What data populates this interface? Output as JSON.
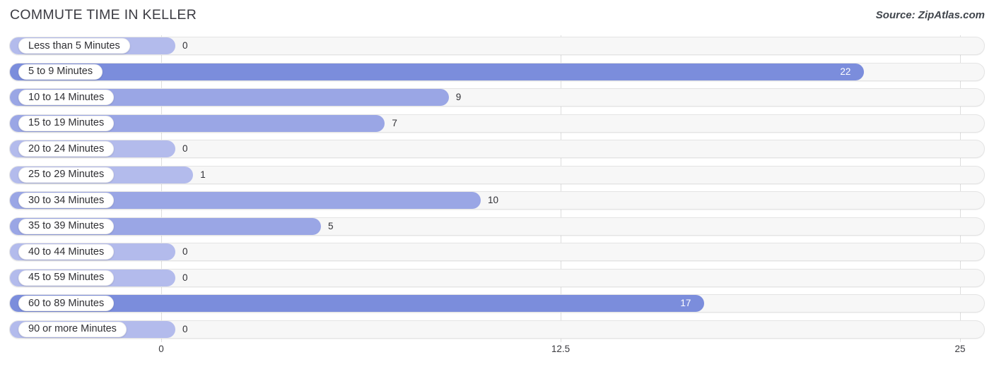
{
  "header": {
    "title": "COMMUTE TIME IN KELLER",
    "source": "Source: ZipAtlas.com"
  },
  "colors": {
    "bar_strong": "#7b8ddc",
    "bar_mid": "#9aa6e5",
    "bar_light": "#b3bbec",
    "track": "#f7f7f7",
    "gridline": "#dedede",
    "title_text": "#3b3b42",
    "value_text": "#303035",
    "value_text_inside": "#ffffff"
  },
  "axis": {
    "ticks": [
      {
        "label": "0",
        "value": 0
      },
      {
        "label": "12.5",
        "value": 12.5
      },
      {
        "label": "25",
        "value": 25
      }
    ],
    "min": 0,
    "max": 25
  },
  "chart_data": {
    "type": "bar",
    "orientation": "horizontal",
    "title": "COMMUTE TIME IN KELLER",
    "subtitle": "Source: ZipAtlas.com",
    "xlabel": "",
    "ylabel": "",
    "xlim": [
      0,
      25
    ],
    "grid": true,
    "legend": "none",
    "categories": [
      "Less than 5 Minutes",
      "5 to 9 Minutes",
      "10 to 14 Minutes",
      "15 to 19 Minutes",
      "20 to 24 Minutes",
      "25 to 29 Minutes",
      "30 to 34 Minutes",
      "35 to 39 Minutes",
      "40 to 44 Minutes",
      "45 to 59 Minutes",
      "60 to 89 Minutes",
      "90 or more Minutes"
    ],
    "values": [
      0,
      22,
      9,
      7,
      0,
      1,
      10,
      5,
      0,
      0,
      17,
      0
    ],
    "value_labels": [
      "0",
      "22",
      "9",
      "7",
      "0",
      "1",
      "10",
      "5",
      "0",
      "0",
      "17",
      "0"
    ]
  },
  "rows": [
    {
      "label": "Less than 5 Minutes",
      "value": 0,
      "value_label": "0",
      "shade": "light",
      "inside": false
    },
    {
      "label": "5 to 9 Minutes",
      "value": 22,
      "value_label": "22",
      "shade": "strong",
      "inside": true
    },
    {
      "label": "10 to 14 Minutes",
      "value": 9,
      "value_label": "9",
      "shade": "mid",
      "inside": false
    },
    {
      "label": "15 to 19 Minutes",
      "value": 7,
      "value_label": "7",
      "shade": "mid",
      "inside": false
    },
    {
      "label": "20 to 24 Minutes",
      "value": 0,
      "value_label": "0",
      "shade": "light",
      "inside": false
    },
    {
      "label": "25 to 29 Minutes",
      "value": 1,
      "value_label": "1",
      "shade": "light",
      "inside": false
    },
    {
      "label": "30 to 34 Minutes",
      "value": 10,
      "value_label": "10",
      "shade": "mid",
      "inside": false
    },
    {
      "label": "35 to 39 Minutes",
      "value": 5,
      "value_label": "5",
      "shade": "mid",
      "inside": false
    },
    {
      "label": "40 to 44 Minutes",
      "value": 0,
      "value_label": "0",
      "shade": "light",
      "inside": false
    },
    {
      "label": "45 to 59 Minutes",
      "value": 0,
      "value_label": "0",
      "shade": "light",
      "inside": false
    },
    {
      "label": "60 to 89 Minutes",
      "value": 17,
      "value_label": "17",
      "shade": "strong",
      "inside": true
    },
    {
      "label": "90 or more Minutes",
      "value": 0,
      "value_label": "0",
      "shade": "light",
      "inside": false
    }
  ]
}
